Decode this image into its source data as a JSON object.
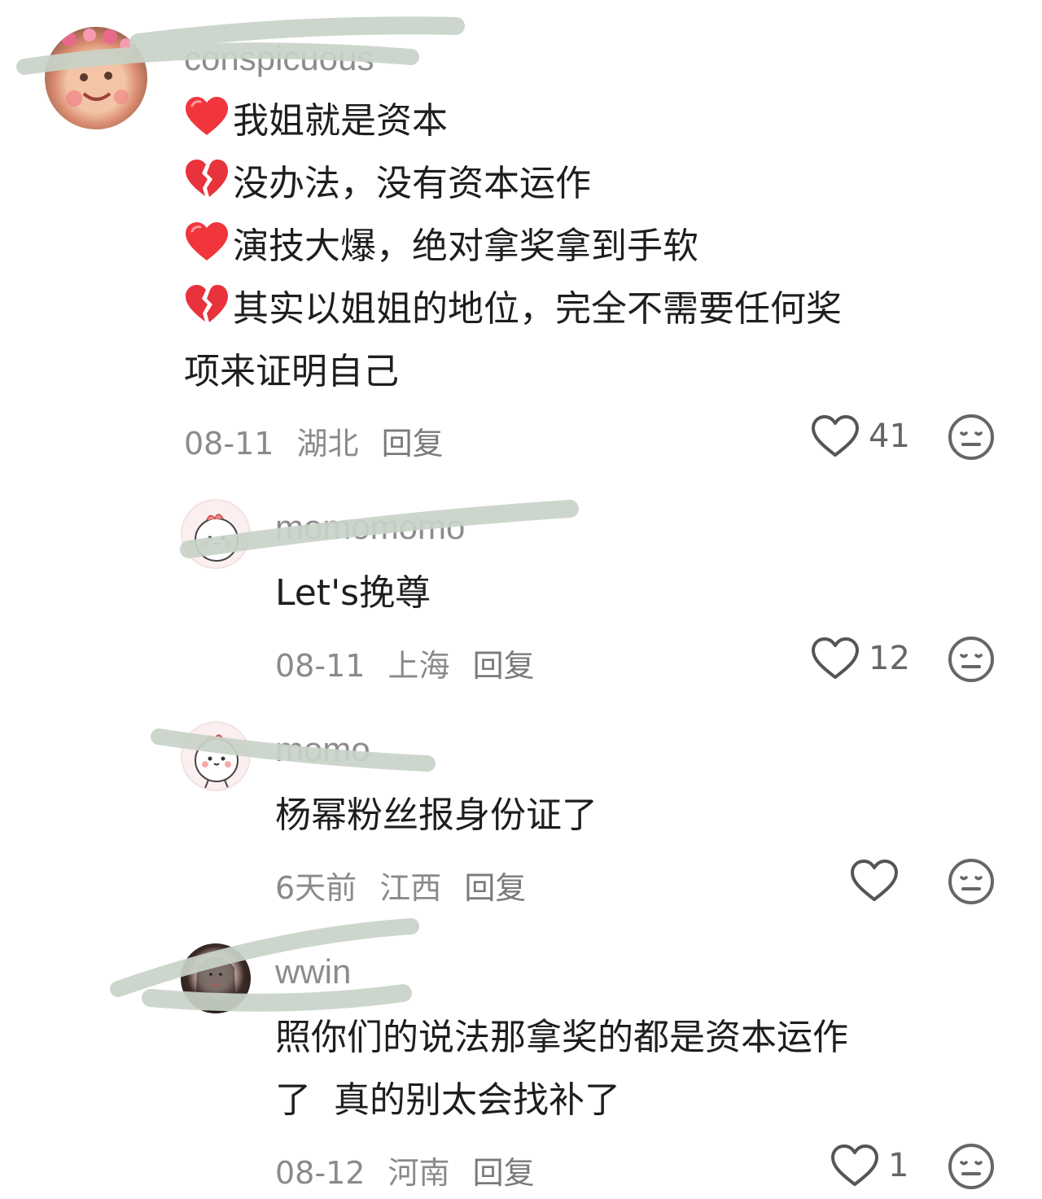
{
  "comments": [
    {
      "username": "conspicuous",
      "lines": [
        "我姐就是资本",
        "没办法，没有资本运作",
        "演技大爆，绝对拿奖拿到手软",
        "其实以姐姐的地位，完全不需要任何奖",
        "项来证明自己"
      ],
      "line_emojis": [
        "red-heart",
        "broken-heart",
        "red-heart",
        "broken-heart",
        ""
      ],
      "date": "08-11",
      "location": "湖北",
      "reply": "回复",
      "likes": "41"
    },
    {
      "username": "momomomo",
      "text": "Let's挽尊",
      "date": "08-11",
      "location": "上海",
      "reply": "回复",
      "likes": "12"
    },
    {
      "username": "momo",
      "text": "杨幂粉丝报身份证了",
      "date": "6天前",
      "location": "江西",
      "reply": "回复",
      "likes": ""
    },
    {
      "username": "wwin",
      "lines": [
        "照你们的说法那拿奖的都是资本运作",
        "了  真的别太会找补了"
      ],
      "date": "08-12",
      "location": "河南",
      "reply": "回复",
      "likes": "1"
    }
  ]
}
